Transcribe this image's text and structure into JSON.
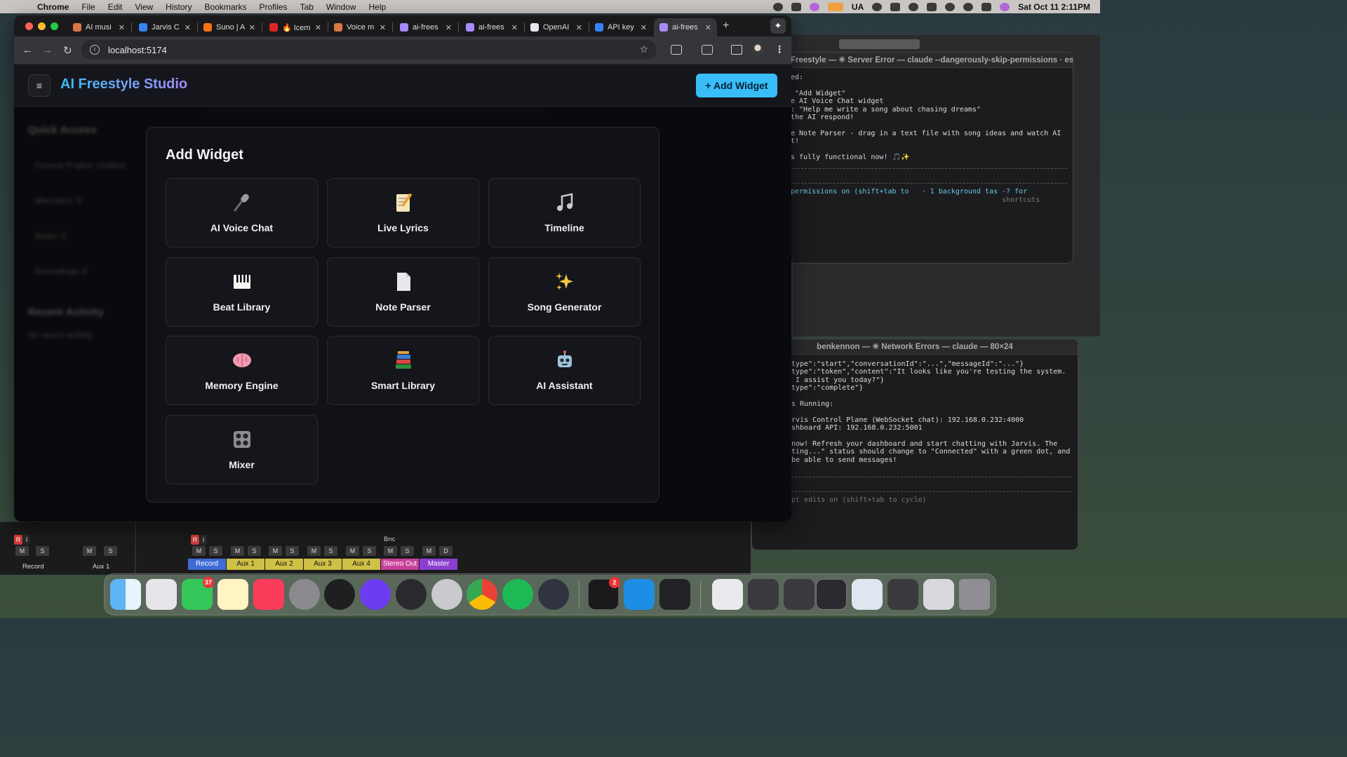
{
  "menubar": {
    "app_name": "Chrome",
    "items": [
      "File",
      "Edit",
      "View",
      "History",
      "Bookmarks",
      "Profiles",
      "Tab",
      "Window",
      "Help"
    ],
    "input_source": "UA",
    "clock": "Sat Oct 11  2:11PM"
  },
  "browser": {
    "tabs": [
      {
        "label": "AI musi",
        "fav_color": "#d97745"
      },
      {
        "label": "Jarvis C",
        "fav_color": "#3b82f6"
      },
      {
        "label": "Suno | A",
        "fav_color": "#f97316"
      },
      {
        "label": "🔥 Icem",
        "fav_color": "#dc2626"
      },
      {
        "label": "Voice m",
        "fav_color": "#d97745"
      },
      {
        "label": "ai-frees",
        "fav_color": "#a78bfa"
      },
      {
        "label": "ai-frees",
        "fav_color": "#a78bfa"
      },
      {
        "label": "OpenAI",
        "fav_color": "#e5e7eb"
      },
      {
        "label": "API key",
        "fav_color": "#3b82f6"
      },
      {
        "label": "ai-frees",
        "fav_color": "#a78bfa"
      }
    ],
    "active_tab_index": 9,
    "url": "localhost:5174"
  },
  "app": {
    "title": "AI Freestyle Studio",
    "add_widget_button": "+ Add Widget",
    "accent": "#38bdf8",
    "sidebar": {
      "quick_access_heading": "Quick Access",
      "items": [
        "Current Project: Untitled",
        "Memories: 0",
        "Beats: 0",
        "Recordings: 0"
      ],
      "recent_heading": "Recent Activity",
      "recent_empty": "No recent activity"
    }
  },
  "modal": {
    "title": "Add Widget",
    "widgets": [
      {
        "label": "AI Voice Chat",
        "icon": "microphone-icon",
        "glyph": "🎤"
      },
      {
        "label": "Live Lyrics",
        "icon": "memo-icon",
        "glyph": "📝"
      },
      {
        "label": "Timeline",
        "icon": "music-note-icon",
        "glyph": "🎵"
      },
      {
        "label": "Beat Library",
        "icon": "piano-icon",
        "glyph": "🎹"
      },
      {
        "label": "Note Parser",
        "icon": "document-icon",
        "glyph": "📄"
      },
      {
        "label": "Song Generator",
        "icon": "sparkles-icon",
        "glyph": "✨"
      },
      {
        "label": "Memory Engine",
        "icon": "brain-icon",
        "glyph": "🧠"
      },
      {
        "label": "Smart Library",
        "icon": "books-icon",
        "glyph": "📚"
      },
      {
        "label": "AI Assistant",
        "icon": "robot-icon",
        "glyph": "🤖"
      },
      {
        "label": "Mixer",
        "icon": "mixer-icon",
        "glyph": "🎛"
      }
    ]
  },
  "terminal_top": {
    "title": "Freestyle — ✳ Server Error — claude --dangerously-skip-permissions · es...",
    "lines": [
      "ed:",
      "",
      " \"Add Widget\"",
      "e AI Voice Chat widget",
      ": \"Help me write a song about chasing dreams\"",
      "the AI respond!",
      "",
      "e Note Parser - drag in a text file with song ideas and watch AI",
      "t!",
      "",
      "s fully functional now! 🎵✨"
    ],
    "status_line": "permissions on (shift+tab to   · 1 background tas ·? for",
    "status_line2": "                                                  shortcuts"
  },
  "terminal_bottom": {
    "title": "benkennon — ✳ Network Errors — claude — 80×24",
    "lines": [
      "type\":\"start\",\"conversationId\":\"...\",\"messageId\":\"...\"}",
      "type\":\"token\",\"content\":\"It looks like you're testing the system.",
      " I assist you today?\"}",
      "type\":\"complete\"}",
      "",
      "s Running:",
      "",
      "rvis Control Plane (WebSocket chat): 192.168.0.232:4000",
      "shboard API: 192.168.0.232:5001",
      "",
      "now! Refresh your dashboard and start chatting with Jarvis. The",
      "ting...\" status should change to \"Connected\" with a green dot, and",
      "be able to send messages!"
    ],
    "footer": "pt edits on (shift+tab to cycle)"
  },
  "daw": {
    "channels": [
      "Record",
      "Aux 1"
    ],
    "buses": [
      "Record",
      "Aux 1",
      "Aux 2",
      "Aux 3",
      "Aux 4",
      "Stereo Out",
      "Master"
    ],
    "bnc_label": "Bnc"
  },
  "dock": {
    "apps": [
      "Finder",
      "Launchpad",
      "Messages",
      "Notes",
      "Music",
      "System Settings",
      "Logic",
      "Arc",
      "Mixer",
      "Compressor",
      "Chrome",
      "Spotify",
      "Atom",
      "Terminal",
      "Docker",
      "Audio"
    ],
    "messages_badge": "37",
    "terminal_badge": "2"
  }
}
